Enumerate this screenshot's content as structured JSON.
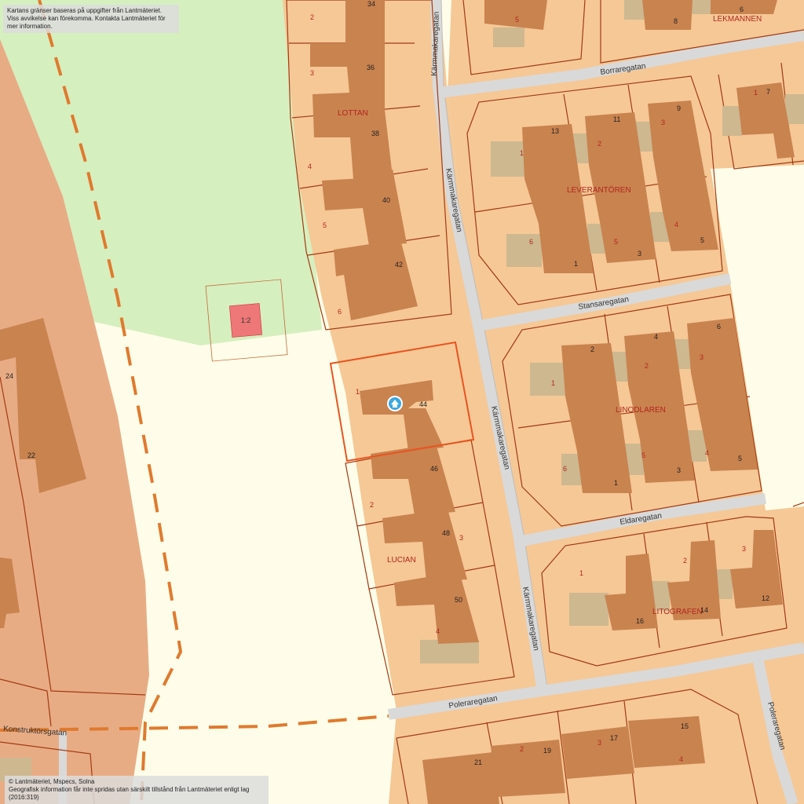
{
  "notices": {
    "top_line1": "Kartans gränser baseras på uppgifter från Lantmäteriet.",
    "top_line2": "Viss avvikelse kan förekomma. Kontakta Lantmäteriet för mer information.",
    "bottom_line1": "© Lantmäteriet, Mspecs, Solna",
    "bottom_line2": "Geografisk information får inte spridas utan särskilt tillstånd från Lantmäteriet enligt lag (2016:319)"
  },
  "streets": {
    "karmmakaregatan_1": "Kärmmakaregatan",
    "karmmakaregatan_2": "Kärmmakaregatan",
    "karmmakaregatan_3": "Kärmmakaregatan",
    "karmmakaregatan_4": "Kärmmakaregatan",
    "borraregatan": "Borraregatan",
    "stansaregatan": "Stansaregatan",
    "eldaregatan": "Eldaregatan",
    "poleraregatan_1": "Poleraregatan",
    "poleraregatan_2": "Poleraregatan",
    "konstruktorsgatan": "Konstruktörsgatan"
  },
  "blocks": {
    "lottan": "LOTTAN",
    "leverantoren": "LEVERANTÖREN",
    "linodlaren": "LINODLAREN",
    "lucian": "LUCIAN",
    "litografen": "LITOGRAFEN",
    "lekmannen": "LEKMANNEN"
  },
  "scale_marker": "1:2",
  "house_numbers": {
    "n34": "34",
    "n36": "36",
    "n38": "38",
    "n40": "40",
    "n42": "42",
    "n44": "44",
    "n46": "46",
    "n48": "48",
    "n50": "50",
    "n24": "24",
    "n22": "22",
    "lev13": "13",
    "lev11": "11",
    "lev9": "9",
    "lev1": "1",
    "lev3": "3",
    "lev5": "5",
    "lin2": "2",
    "lin4": "4",
    "lin6": "6",
    "lin1": "1",
    "lin3": "3",
    "lin5": "5",
    "lit16": "16",
    "lit14": "14",
    "lit12": "12",
    "pol21": "21",
    "pol19": "19",
    "pol17": "17",
    "pol15": "15",
    "top8": "8",
    "top6": "6",
    "top7": "7"
  },
  "lot_numbers": {
    "l2": "2",
    "l3": "3",
    "l4": "4",
    "l5": "5",
    "l6": "6",
    "sel1": "1",
    "luc2": "2",
    "luc3": "3",
    "luc4": "4",
    "lev1": "1",
    "lev2": "2",
    "lev3": "3",
    "lev4": "4",
    "lev5": "5",
    "lev6": "6",
    "lin1": "1",
    "lin2": "2",
    "lin3": "3",
    "lin4": "4",
    "lin5": "5",
    "lin6": "6",
    "lit1": "1",
    "lit2": "2",
    "lit3": "3",
    "pol2": "2",
    "pol3": "3",
    "pol4": "4",
    "top5": "5",
    "top1": "1"
  },
  "colors": {
    "plot": "#f5c896",
    "building": "#c9834f",
    "outbuilding": "#cdb890",
    "park": "#d6efbf",
    "open_land": "#fffde9",
    "road": "#d9d9d9",
    "boundary": "#a33a12",
    "selected": "#e8541f",
    "path": "#e07a2e",
    "industrial": "#e8ac85",
    "marker": "#ee7777",
    "home_pin": "#3aa7e0"
  },
  "icons": {
    "home_marker": "home-pin-icon"
  }
}
